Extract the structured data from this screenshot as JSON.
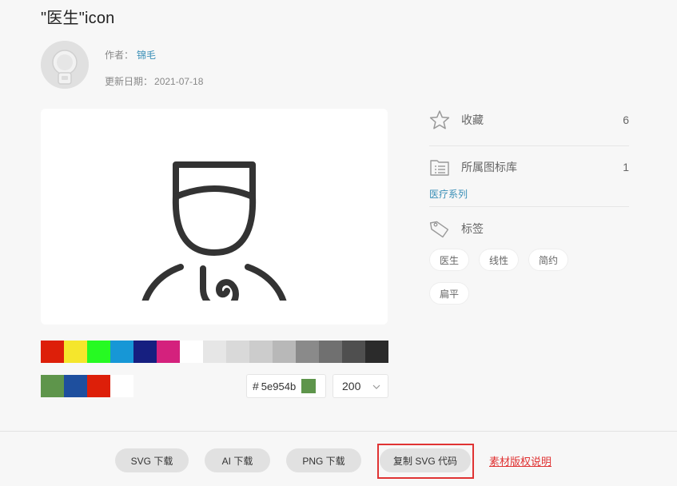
{
  "page": {
    "title": "\"医生\"icon"
  },
  "author": {
    "label": "作者：",
    "name": "锦毛",
    "date_label": "更新日期：",
    "date": "2021-07-18"
  },
  "icon": {
    "name": "doctor-icon",
    "color": "#333333"
  },
  "palette": {
    "row1": [
      "#dd1f09",
      "#f5e62c",
      "#26fa22",
      "#1797d6",
      "#161f80",
      "#d4217d",
      "#ffffff",
      "#e6e6e6",
      "#d9d9d9",
      "#cccccc",
      "#b8b8b8",
      "#8a8a8a",
      "#707070",
      "#4f4f4f",
      "#2b2b2b"
    ],
    "row2": [
      "#5e954b",
      "#1e4f9e",
      "#dd1f09",
      "#ffffff"
    ]
  },
  "color_input": {
    "hash": "#",
    "value": "5e954b",
    "preview": "#5e954b"
  },
  "size_select": {
    "value": "200"
  },
  "sidebar": {
    "favorites": {
      "label": "收藏",
      "count": "6"
    },
    "library": {
      "label": "所属图标库",
      "count": "1",
      "link": "医疗系列"
    },
    "tags": {
      "label": "标签",
      "items": [
        "医生",
        "线性",
        "简约",
        "扁平"
      ]
    }
  },
  "actions": {
    "svg_download": "SVG 下载",
    "ai_download": "AI 下载",
    "png_download": "PNG 下载",
    "copy_svg": "复制 SVG 代码",
    "license": "素材版权说明"
  }
}
